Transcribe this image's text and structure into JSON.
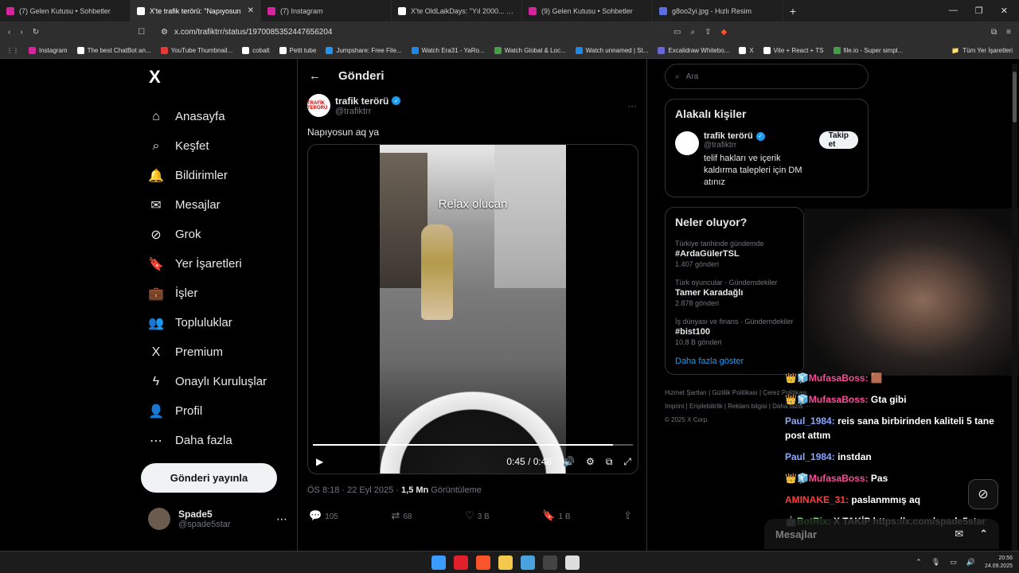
{
  "tabs": [
    {
      "label": "(7) Gelen Kutusu • Sohbetler",
      "color": "#d6249f",
      "active": false
    },
    {
      "label": "X'te trafik terörü: \"Napıyosun",
      "color": "#ffffff",
      "active": true
    },
    {
      "label": "(7) Instagram",
      "color": "#d6249f",
      "active": false
    },
    {
      "label": "X'te OldLaikDays: \"Yıl 2000... Polisler",
      "color": "#ffffff",
      "active": false
    },
    {
      "label": "(9) Gelen Kutusu • Sohbetler",
      "color": "#d6249f",
      "active": false
    },
    {
      "label": "g8oo2yi.jpg - Hızlı Resim",
      "color": "#5b6ee1",
      "active": false
    }
  ],
  "address": {
    "url": "x.com/trafiktrr/status/1970085352447656204"
  },
  "bookmarks": [
    {
      "label": "Instagram",
      "color": "#d6249f"
    },
    {
      "label": "The best ChatBot an...",
      "color": "#ffffff"
    },
    {
      "label": "YouTube Thumbnail...",
      "color": "#e53935"
    },
    {
      "label": "cobalt",
      "color": "#ffffff"
    },
    {
      "label": "Petit tube",
      "color": "#ffffff"
    },
    {
      "label": "Jumpshare: Free File...",
      "color": "#2196f3"
    },
    {
      "label": "Watch Era31 - YaRo...",
      "color": "#1e88e5"
    },
    {
      "label": "Watch Global & Loc...",
      "color": "#43a047"
    },
    {
      "label": "Watch unnamed | St...",
      "color": "#1e88e5"
    },
    {
      "label": "Excalidraw Whitebo...",
      "color": "#6965db"
    },
    {
      "label": "X",
      "color": "#ffffff"
    },
    {
      "label": "Vite + React + TS",
      "color": "#ffffff"
    },
    {
      "label": "file.io - Super simpl...",
      "color": "#43a047"
    }
  ],
  "bookmarks_all": "Tüm Yer İşaretleri",
  "nav": {
    "logo": "X",
    "items": [
      {
        "label": "Anasayfa",
        "icon": "⌂"
      },
      {
        "label": "Keşfet",
        "icon": "⌕"
      },
      {
        "label": "Bildirimler",
        "icon": "🔔"
      },
      {
        "label": "Mesajlar",
        "icon": "✉"
      },
      {
        "label": "Grok",
        "icon": "⊘"
      },
      {
        "label": "Yer İşaretleri",
        "icon": "🔖"
      },
      {
        "label": "İşler",
        "icon": "💼"
      },
      {
        "label": "Topluluklar",
        "icon": "👥"
      },
      {
        "label": "Premium",
        "icon": "X"
      },
      {
        "label": "Onaylı Kuruluşlar",
        "icon": "ϟ"
      },
      {
        "label": "Profil",
        "icon": "👤"
      },
      {
        "label": "Daha fazla",
        "icon": "⋯"
      }
    ],
    "post_button": "Gönderi yayınla"
  },
  "account": {
    "name": "Spade5",
    "handle": "@spade5star"
  },
  "post": {
    "header": "Gönderi",
    "author_name": "trafik terörü",
    "author_handle": "@trafiktrr",
    "avatar_text": "TRAFİK TERÖRÜ",
    "text": "Napıyosun aq ya",
    "video_caption": "Relax olucan",
    "video_time": "0:45 / 0:48",
    "video_progress": 0.9375,
    "timestamp": "ÖS 8:18 · 22 Eyl 2025 · ",
    "views_count": "1,5 Mn",
    "views_label": " Görüntüleme",
    "replies": "105",
    "reposts": "68",
    "likes": "3 B",
    "bookmarks": "1 B"
  },
  "search": {
    "placeholder": "Ara"
  },
  "related": {
    "title": "Alakalı kişiler",
    "name": "trafik terörü",
    "handle": "@trafiktrr",
    "follow": "Takip et",
    "bio": "telif hakları ve içerik kaldırma talepleri için DM atınız"
  },
  "trends": {
    "title": "Neler oluyor?",
    "items": [
      {
        "category": "Türkiye tarihinde gündemde",
        "title": "#ArdaGülerTSL",
        "count": "1.407 gönderi"
      },
      {
        "category": "Türk oyuncular · Gündemdekiler",
        "title": "Tamer Karadağlı",
        "count": "2.878 gönderi"
      },
      {
        "category": "İş dünyası ve finans · Gündemdekiler",
        "title": "#bist100",
        "count": "10,8 B gönderi"
      }
    ],
    "show_more": "Daha fazla göster"
  },
  "footer": {
    "line1": "Hizmet Şartları  |  Gizlilik Politikası  |  Çerez Politikası",
    "line2": "Imprint  |  Erişilebilirlik  |  Reklam bilgisi  |  Daha fazla ···",
    "line3": "© 2025 X Corp."
  },
  "chat": [
    {
      "user": "MufasaBoss:",
      "color": "#ff4a9a",
      "badge": "👑🧊",
      "msg": "🟫"
    },
    {
      "user": "MufasaBoss:",
      "color": "#ff4a9a",
      "badge": "👑🧊",
      "msg": "Gta gibi"
    },
    {
      "user": "Paul_1984:",
      "color": "#8aa7ff",
      "badge": "",
      "msg": "reis sana birbirinden kaliteli 5 tane post attım"
    },
    {
      "user": "Paul_1984:",
      "color": "#8aa7ff",
      "badge": "",
      "msg": "instdan"
    },
    {
      "user": "MufasaBoss:",
      "color": "#ff4a9a",
      "badge": "👑🧊",
      "msg": "Pas"
    },
    {
      "user": "AMINAKE_31:",
      "color": "#ff3b3b",
      "badge": "",
      "msg": "paslanmmış aq"
    },
    {
      "user": "BotRix:",
      "color": "#6cff6c",
      "badge": "🤖",
      "msg": "X TAKİP https://x.com/spade5star"
    }
  ],
  "messages_drawer": "Mesajlar",
  "taskbar": {
    "icons": [
      {
        "name": "windows-start-icon",
        "color": "#3b9cff"
      },
      {
        "name": "opera-icon",
        "color": "#e0202a"
      },
      {
        "name": "brave-icon",
        "color": "#fb542b"
      },
      {
        "name": "folder-icon",
        "color": "#f2c94c"
      },
      {
        "name": "app-icon",
        "color": "#4aa3df"
      },
      {
        "name": "obs-icon",
        "color": "#444444"
      },
      {
        "name": "notes-icon",
        "color": "#dddddd"
      }
    ],
    "time": "20:56",
    "date": "24.09.2025"
  }
}
